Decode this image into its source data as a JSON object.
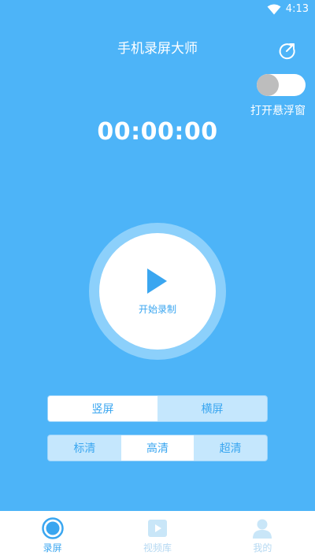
{
  "status_bar": {
    "time": "4:13"
  },
  "header": {
    "title": "手机录屏大师"
  },
  "floating_window": {
    "label": "打开悬浮窗",
    "enabled": false
  },
  "timer": {
    "value": "00:00:00"
  },
  "record": {
    "label": "开始录制"
  },
  "orientation": {
    "options": [
      "竖屏",
      "横屏"
    ],
    "selected": "竖屏"
  },
  "quality": {
    "options": [
      "标清",
      "高清",
      "超清"
    ],
    "selected": "高清"
  },
  "nav": {
    "items": [
      {
        "label": "录屏",
        "icon": "record-circle-icon",
        "active": true
      },
      {
        "label": "视频库",
        "icon": "video-library-icon",
        "active": false
      },
      {
        "label": "我的",
        "icon": "user-icon",
        "active": false
      }
    ]
  },
  "colors": {
    "primary": "#4db4f8",
    "accent": "#3aa6f0",
    "ring": "#8cd0fb",
    "segment_bg": "#c5e7fd",
    "inactive": "#b4d8f2"
  }
}
